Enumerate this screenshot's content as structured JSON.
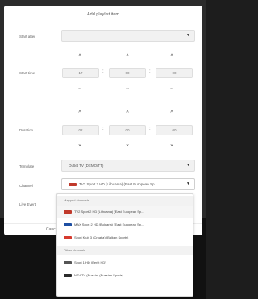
{
  "dialog": {
    "title": "Add playlist item",
    "start_after": {
      "label": "Start after",
      "value": ""
    },
    "start_time": {
      "label": "Start time",
      "hours": "17",
      "minutes": "00",
      "seconds": "00"
    },
    "duration": {
      "label": "Duration",
      "hours": "02",
      "minutes": "00",
      "seconds": "00"
    },
    "template": {
      "label": "Template",
      "value": "Outlet TV (DEMO/TT)"
    },
    "channel": {
      "label": "Channel",
      "value": "TV2 Sport 2 HD (Lithuania) (East European Sp..."
    },
    "live_event": {
      "label": "Live Event"
    },
    "cancel_label": "Canc"
  },
  "dropdown": {
    "groups": [
      {
        "label": "Mapped channels"
      },
      {
        "label": "Other channels"
      }
    ],
    "items": [
      {
        "label": "TV2 Sport 2 HD (Lithuania) (East European Sp...",
        "logo_color": "#c0392b",
        "selected": true
      },
      {
        "label": "MAX Sport 2 HD (Bulgaria) (East European Sp...",
        "logo_color": "#1e4fa3",
        "selected": false
      },
      {
        "label": "Sport Klub 3 (Croatia) (Balkan Sports)",
        "logo_color": "#d63b2f",
        "selected": false
      },
      {
        "label": "Sport 1 HD (Berlit HD)",
        "logo_color": "#555555",
        "selected": false
      },
      {
        "label": "NTV TV (Russia) (Russian Sports)",
        "logo_color": "#2b2b2b",
        "selected": false
      }
    ]
  },
  "colors": {
    "modal_bg": "#ffffff",
    "field_bg": "#f1f1f1",
    "overlay_bg": "#2b2b2b"
  }
}
